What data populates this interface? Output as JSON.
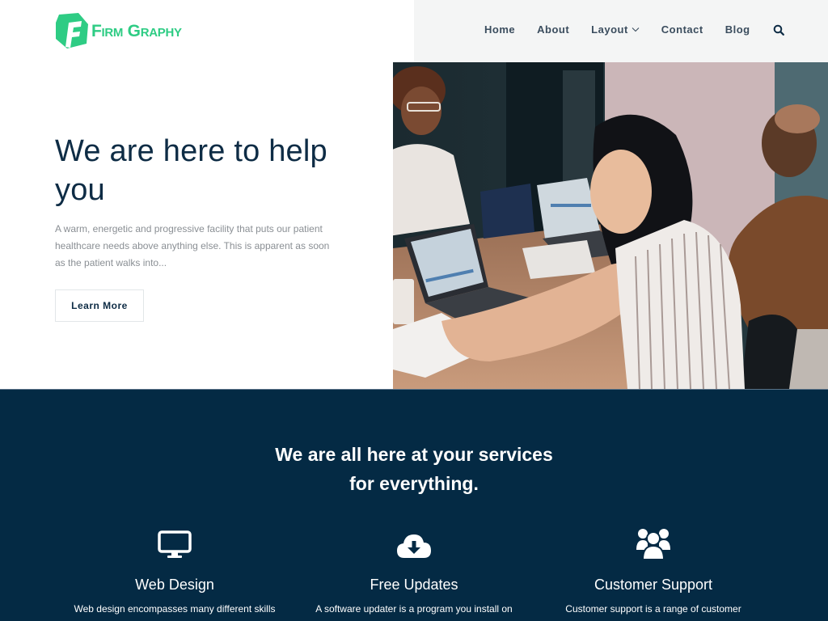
{
  "brand": {
    "name": "Firm Graphy",
    "color": "#2ecc84"
  },
  "nav": {
    "items": [
      {
        "label": "Home"
      },
      {
        "label": "About"
      },
      {
        "label": "Layout",
        "has_dropdown": true
      },
      {
        "label": "Contact"
      },
      {
        "label": "Blog"
      }
    ],
    "search_icon": "search-icon"
  },
  "hero": {
    "title": "We are here to help you",
    "description": "A warm, energetic and progressive facility that puts our patient healthcare needs above anything else. This is apparent as soon as the patient walks into...",
    "button_label": "Learn More",
    "image_alt": "Team meeting with laptops"
  },
  "services": {
    "title_line1": "We are all here at your services",
    "title_line2": "for everything.",
    "background": "#042a44",
    "items": [
      {
        "icon": "desktop-icon",
        "title": "Web Design",
        "description": "Web design encompasses many different skills"
      },
      {
        "icon": "cloud-download-icon",
        "title": "Free Updates",
        "description": "A software updater is a program you install on"
      },
      {
        "icon": "users-icon",
        "title": "Customer Support",
        "description": "Customer support is a range of customer"
      }
    ]
  }
}
